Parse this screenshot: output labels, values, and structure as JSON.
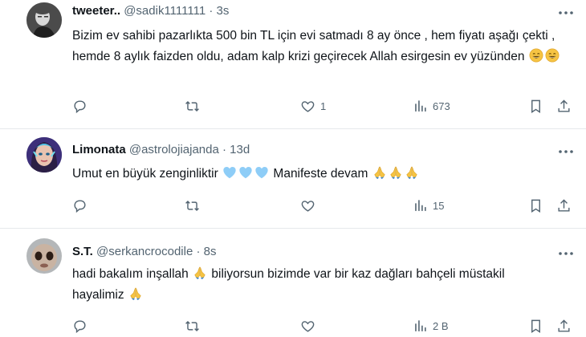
{
  "tweets": [
    {
      "name": "tweeter..",
      "handle": "@sadik1111111",
      "dot": "·",
      "time": "3s",
      "text": "Bizim ev sahibi pazarlıkta 500 bin TL için evi satmadı 8 ay önce , hem fiyatı aşağı çekti , hemde 8 aylık faizden oldu, adam kalp krizi geçirecek Allah esirgesin ev yüzünden",
      "likes": "1",
      "views": "673"
    },
    {
      "name": "Limonata",
      "handle": "@astrolojiajanda",
      "dot": "·",
      "time": "13d",
      "text_a": "Umut en büyük zenginliktir",
      "text_b": "Manifeste devam",
      "views": "15"
    },
    {
      "name": "S.T.",
      "handle": "@serkancrocodile",
      "dot": "·",
      "time": "8s",
      "text_a": "hadi bakalım inşallah",
      "text_b": "biliyorsun bizimde var bir kaz dağları bahçeli müstakil  hayalimiz",
      "views": "2 B"
    }
  ],
  "colors": {
    "text": "#0f1419",
    "secondary": "#536471",
    "divider": "#e6e9ec",
    "heart_emoji": "#8ecdf7",
    "prayer_emoji": "#f6c443"
  },
  "icons": [
    "more-icon",
    "reply-icon",
    "retweet-icon",
    "like-icon",
    "views-icon",
    "bookmark-icon",
    "share-icon",
    "grin-emoji",
    "blue-heart-emoji",
    "folded-hands-emoji"
  ]
}
